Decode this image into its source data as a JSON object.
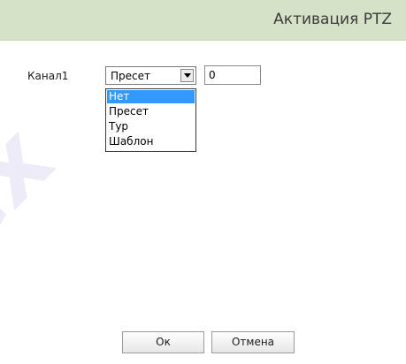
{
  "header": {
    "title": "Активация PTZ"
  },
  "form": {
    "channel_label": "Канал1",
    "select": {
      "value": "Пресет",
      "options": [
        "Нет",
        "Пресет",
        "Тур",
        "Шаблон"
      ],
      "highlighted_option": "Нет"
    },
    "number_value": "0"
  },
  "buttons": {
    "ok": "Ок",
    "cancel": "Отмена"
  },
  "colors": {
    "header_bg": "#d6e2c7",
    "highlight": "#3399ff",
    "watermark": "#ecebf7"
  }
}
